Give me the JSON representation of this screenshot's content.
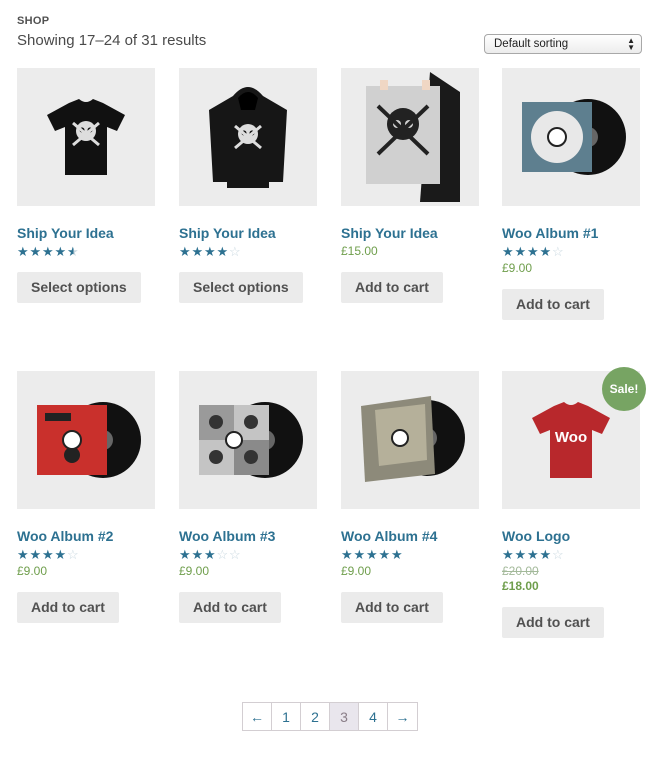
{
  "header": {
    "shop_label": "SHOP",
    "result_count": "Showing 17–24 of 31 results",
    "sort": {
      "selected": "Default sorting"
    }
  },
  "colors": {
    "link": "#2d7191",
    "price": "#6f9e4c",
    "sale_badge": "#77a463",
    "button_bg": "#ebebeb"
  },
  "products": [
    {
      "title": "Ship Your Idea",
      "rating": 4.5,
      "price": "",
      "button": "Select options",
      "image": "black-tshirt-skull"
    },
    {
      "title": "Ship Your Idea",
      "rating": 4,
      "price": "",
      "button": "Select options",
      "image": "black-hoodie-skull"
    },
    {
      "title": "Ship Your Idea",
      "rating": null,
      "price": "£15.00",
      "button": "Add to cart",
      "image": "poster-skull"
    },
    {
      "title": "Woo Album #1",
      "rating": 4,
      "price": "£9.00",
      "button": "Add to cart",
      "image": "vinyl-blue"
    },
    {
      "title": "Woo Album #2",
      "rating": 4,
      "price": "£9.00",
      "button": "Add to cart",
      "image": "vinyl-red"
    },
    {
      "title": "Woo Album #3",
      "rating": 3,
      "price": "£9.00",
      "button": "Add to cart",
      "image": "vinyl-grid"
    },
    {
      "title": "Woo Album #4",
      "rating": 5,
      "price": "£9.00",
      "button": "Add to cart",
      "image": "vinyl-yellow"
    },
    {
      "title": "Woo Logo",
      "rating": 4,
      "price_old": "£20.00",
      "price": "£18.00",
      "button": "Add to cart",
      "sale": "Sale!",
      "image": "red-tshirt-woo"
    }
  ],
  "logo_text": "Woo",
  "pagination": {
    "prev": "←",
    "pages": [
      "1",
      "2",
      "3",
      "4"
    ],
    "current": "3",
    "next": "→"
  }
}
